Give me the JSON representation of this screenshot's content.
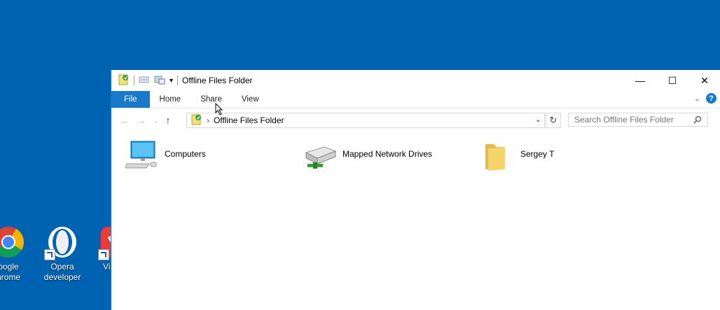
{
  "desktop": {
    "icons": [
      {
        "label_line1": "oogle",
        "label_line2": "hrome",
        "name": "chrome"
      },
      {
        "label_line1": "Opera",
        "label_line2": "developer",
        "name": "opera-developer"
      },
      {
        "label_line1": "Vi",
        "label_line2": "",
        "name": "vivaldi"
      }
    ]
  },
  "window": {
    "title": "Offline Files Folder",
    "controls": {
      "minimize": "—",
      "maximize": "☐",
      "close": "✕"
    }
  },
  "ribbon": {
    "tabs": [
      "File",
      "Home",
      "Share",
      "View"
    ]
  },
  "address": {
    "crumb_sep": "›",
    "path": "Offline Files Folder"
  },
  "search": {
    "placeholder": "Search Offline Files Folder"
  },
  "items": [
    {
      "label": "Computers",
      "icon": "computer-icon"
    },
    {
      "label": "Mapped Network Drives",
      "icon": "network-drive-icon"
    },
    {
      "label": "Sergey T",
      "icon": "folder-icon"
    }
  ],
  "colors": {
    "desktop": "#0063b1",
    "accent": "#1979ca",
    "folder": "#f5d46b"
  }
}
